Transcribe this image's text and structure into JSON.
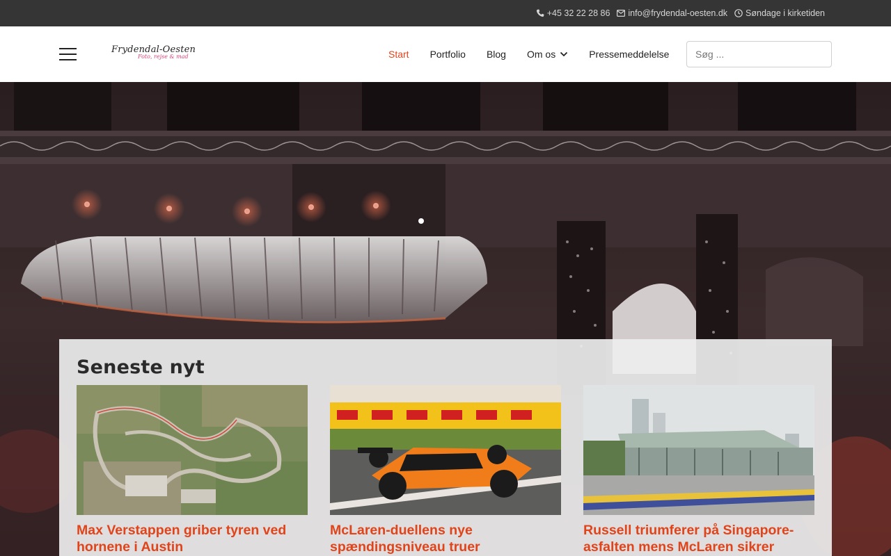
{
  "topbar": {
    "phone": "+45 32 22 28 86",
    "email": "info@frydendal-oesten.dk",
    "hours": "Søndage i kirketiden"
  },
  "header": {
    "logo_text": "Frydendal-Oesten",
    "logo_tagline": "Foto, rejse & mad",
    "nav": [
      {
        "label": "Start",
        "active": true
      },
      {
        "label": "Portfolio",
        "active": false
      },
      {
        "label": "Blog",
        "active": false
      },
      {
        "label": "Om os",
        "active": false,
        "has_dropdown": true
      },
      {
        "label": "Pressemeddelelse",
        "active": false
      }
    ],
    "search_placeholder": "Søg ..."
  },
  "news": {
    "heading": "Seneste nyt",
    "articles": [
      {
        "title": "Max Verstappen griber tyren ved hornene i Austin",
        "image": "aerial-circuit-map"
      },
      {
        "title": "McLaren-duellens nye spændingsniveau truer",
        "image": "orange-f1-car"
      },
      {
        "title": "Russell triumferer på Singapore-asfalten mens McLaren sikrer",
        "image": "pit-building-grandstand"
      }
    ]
  },
  "colors": {
    "accent": "#e0441b",
    "topbar_bg": "#353535",
    "panel_bg": "#eeeeee"
  }
}
